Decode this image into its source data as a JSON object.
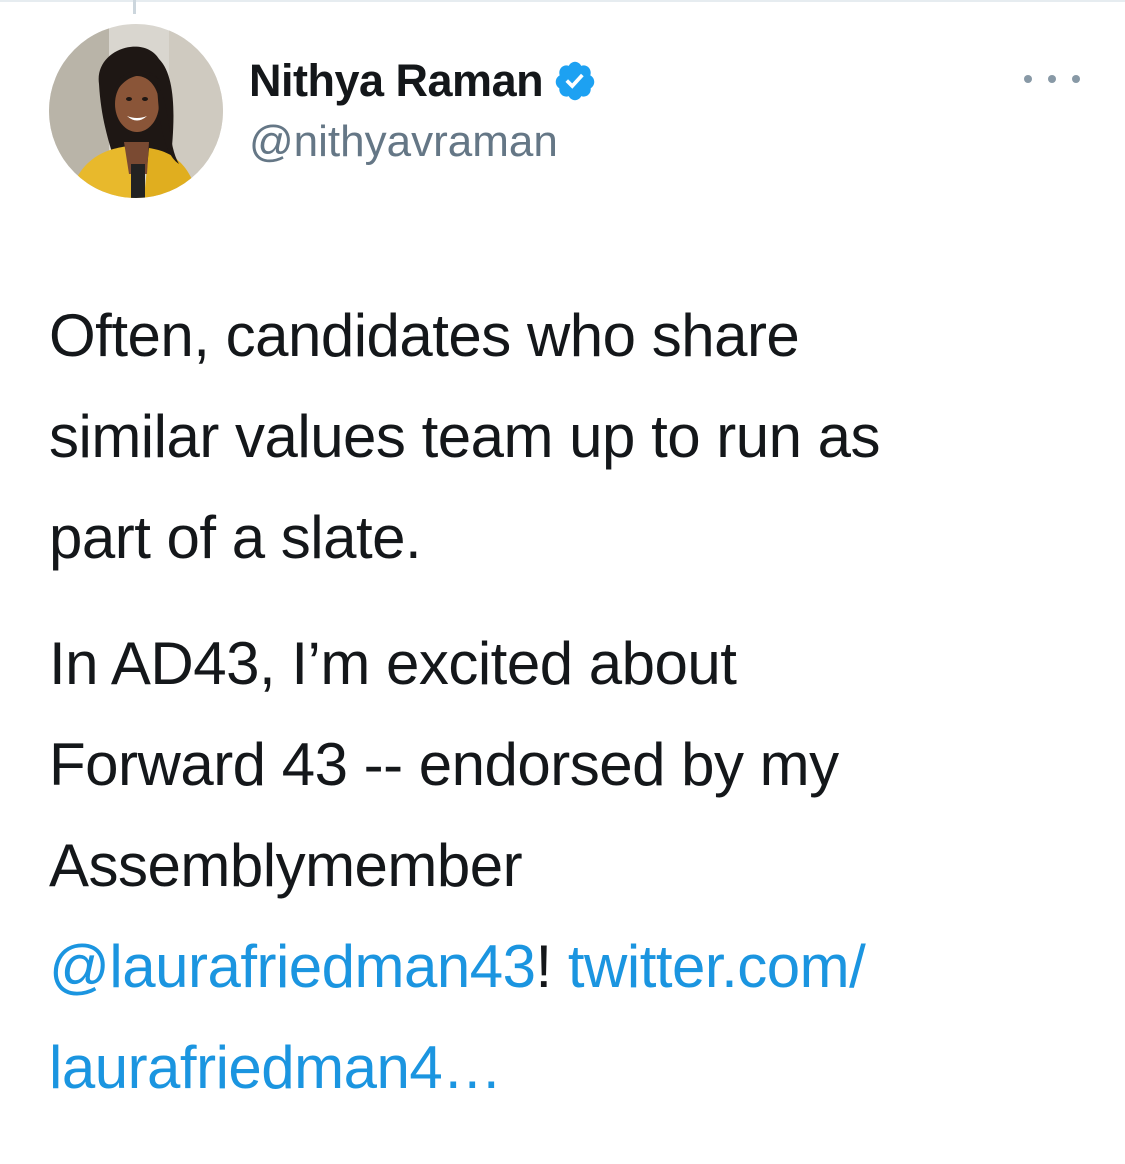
{
  "tweet": {
    "author": {
      "display_name": "Nithya Raman",
      "handle": "@nithyavraman",
      "verified": true
    },
    "paragraph_1": [
      "Often, candidates who share",
      "similar values team up to run as",
      "part of a slate."
    ],
    "paragraph_2": {
      "line_1": "In AD43, I’m excited about",
      "line_2": "Forward 43 -- endorsed by my",
      "line_3": "Assemblymember",
      "mention": "@laurafriedman43",
      "exclamation": "!",
      "link_part_1": "twitter.com/",
      "link_part_2": "laurafriedman4…"
    }
  },
  "colors": {
    "text": "#14171a",
    "secondary": "#657786",
    "link": "#1b95e0",
    "verified_badge": "#1da1f2"
  },
  "icons": {
    "verified": "verified-badge-icon",
    "more": "more-options-icon"
  }
}
